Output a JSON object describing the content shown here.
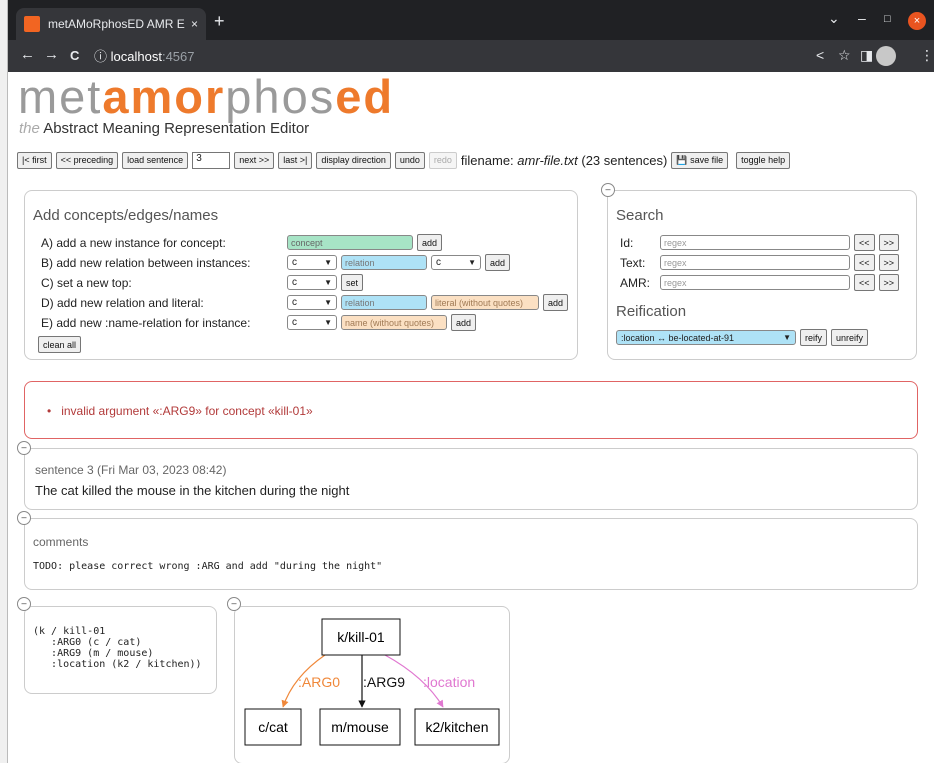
{
  "browser": {
    "tab_title": "metAMoRphosED AMR Ec",
    "tab_close": "×",
    "new_tab": "+",
    "back": "←",
    "forward": "→",
    "reload": "C",
    "info_icon": "ⓘ",
    "url_host": "localhost",
    "url_port": ":4567",
    "win_minimize": "–",
    "win_maximize": "□",
    "win_close": "×",
    "win_chevron": "⌄",
    "share_icon": "<",
    "star_icon": "☆",
    "sidepanel_icon": "◨",
    "menu_icon": "⋮"
  },
  "logo": {
    "part1": "met",
    "part2": "amor",
    "part3": "phos",
    "part4": "ed"
  },
  "subtitle": {
    "the": "the",
    "rest": "Abstract Meaning Representation Editor"
  },
  "nav": {
    "first": "|< first",
    "preceding": "<< preceding",
    "load": "load sentence",
    "sentence_number": "3",
    "next": "next >>",
    "last": "last >|",
    "display_direction": "display direction",
    "undo": "undo",
    "redo": "redo",
    "filename_label": "filename:",
    "filename": "amr-file.txt",
    "sentence_count": "(23 sentences)",
    "save": "💾 save file",
    "toggle_help": "toggle help"
  },
  "add_panel": {
    "title": "Add concepts/edges/names",
    "rows": [
      {
        "label": "A)  add a new instance for concept:"
      },
      {
        "label": "B)  add new relation between instances:"
      },
      {
        "label": "C)  set a new top:"
      },
      {
        "label": "D)  add new relation and literal:"
      },
      {
        "label": "E)  add new :name-relation for instance:"
      }
    ],
    "concept_placeholder": "concept",
    "relation_placeholder": "relation",
    "literal_placeholder": "literal (without quotes)",
    "name_placeholder": "name (without quotes)",
    "instance_value": "c",
    "add": "add",
    "set": "set",
    "clean_all": "clean all"
  },
  "search_panel": {
    "title": "Search",
    "fields": [
      {
        "label": "Id:"
      },
      {
        "label": "Text:"
      },
      {
        "label": "AMR:"
      }
    ],
    "placeholder": "regex",
    "prev": "<<",
    "next": ">>",
    "reification_title": "Reification",
    "reification_value": ":location ↔ be-located-at-91",
    "reify": "reify",
    "unreify": "unreify"
  },
  "error": {
    "message": "invalid argument «:ARG9» for concept «kill-01»"
  },
  "sentence": {
    "header": "sentence 3 (Fri Mar 03, 2023 08:42)",
    "text": "The cat killed the mouse in the kitchen during the night"
  },
  "comments": {
    "title": "comments",
    "text": "TODO: please correct wrong :ARG and add \"during the night\""
  },
  "penman": [
    "(k / kill-01",
    "   :ARG0 (c / cat)",
    "   :ARG9 (m / mouse)",
    "   :location (k2 / kitchen))"
  ],
  "graph": {
    "root": "k/kill-01",
    "nodes": [
      "c/cat",
      "m/mouse",
      "k2/kitchen"
    ],
    "edges": [
      {
        "label": ":ARG0",
        "color": "#f0883a"
      },
      {
        "label": ":ARG9",
        "color": "#111111"
      },
      {
        "label": ":location",
        "color": "#e077d0"
      }
    ]
  },
  "collapse_symbol": "–"
}
